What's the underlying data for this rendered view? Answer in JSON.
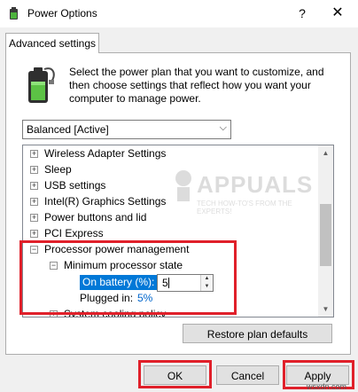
{
  "window": {
    "title": "Power Options",
    "help_glyph": "?",
    "close_glyph": "✕"
  },
  "tab": {
    "label": "Advanced settings"
  },
  "intro": {
    "text": "Select the power plan that you want to customize, and then choose settings that reflect how you want your computer to manage power."
  },
  "plan_dropdown": {
    "selected": "Balanced [Active]",
    "arrow": "⌵"
  },
  "tree": {
    "items": [
      {
        "label": "Wireless Adapter Settings",
        "state": "+"
      },
      {
        "label": "Sleep",
        "state": "+"
      },
      {
        "label": "USB settings",
        "state": "+"
      },
      {
        "label": "Intel(R) Graphics Settings",
        "state": "+"
      },
      {
        "label": "Power buttons and lid",
        "state": "+"
      },
      {
        "label": "PCI Express",
        "state": "+"
      },
      {
        "label": "Processor power management",
        "state": "−"
      },
      {
        "label": "Minimum processor state",
        "state": "−"
      },
      {
        "label": "On battery (%):",
        "value": "5"
      },
      {
        "label": "Plugged in:",
        "value": "5%"
      },
      {
        "label": "System cooling policy",
        "state": "+"
      }
    ]
  },
  "buttons": {
    "restore": "Restore plan defaults",
    "ok": "OK",
    "cancel": "Cancel",
    "apply": "Apply"
  },
  "watermark": {
    "brand": "APPUALS",
    "tagline": "TECH HOW-TO'S FROM THE EXPERTS!"
  },
  "credit": "wsxdn.com",
  "colors": {
    "highlight_border": "#e0202a",
    "selection": "#0078d7",
    "link_value": "#0066cc"
  }
}
